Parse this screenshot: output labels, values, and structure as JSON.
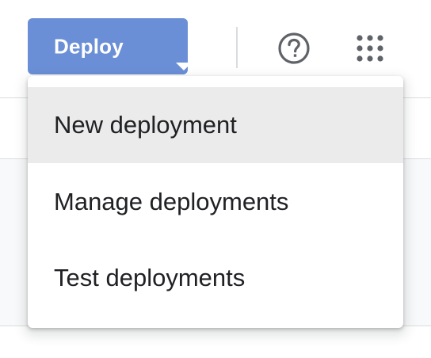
{
  "toolbar": {
    "deploy_label": "Deploy",
    "help_icon": "help-circle-icon",
    "apps_icon": "apps-grid-icon"
  },
  "deploy_menu": {
    "items": [
      {
        "label": "New deployment",
        "highlighted": true
      },
      {
        "label": "Manage deployments",
        "highlighted": false
      },
      {
        "label": "Test deployments",
        "highlighted": false
      }
    ]
  },
  "colors": {
    "deploy_button": "#6a8fd6",
    "highlight": "#ebebeb",
    "icon": "#5f6368",
    "text": "#202124"
  }
}
